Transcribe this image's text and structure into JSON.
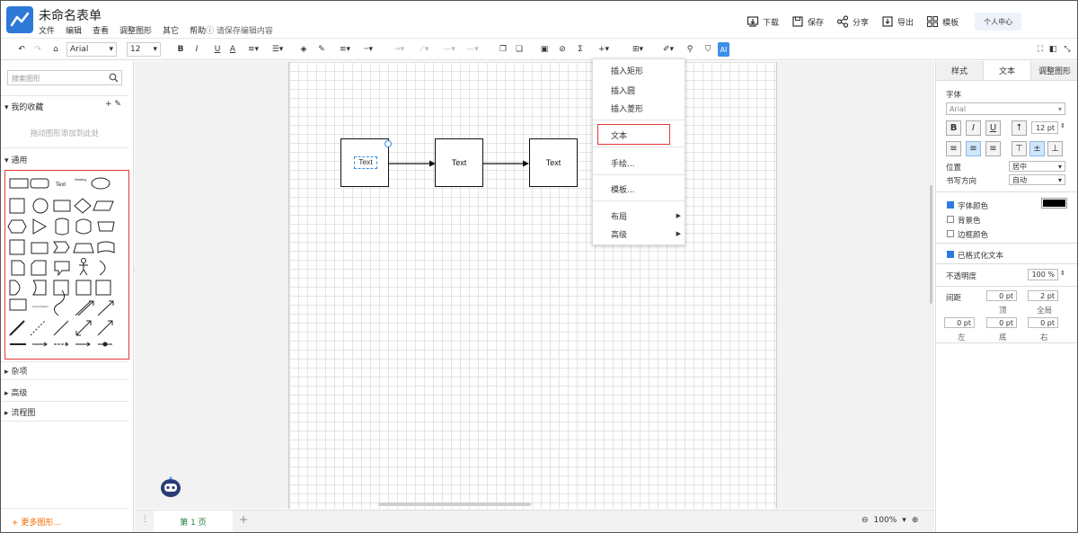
{
  "header": {
    "title": "未命名表单",
    "menu": [
      "文件",
      "编辑",
      "查看",
      "调整图形",
      "其它",
      "帮助"
    ],
    "autosave": "请保存编辑内容",
    "actions": [
      {
        "icon": "download-icon",
        "label": "下载"
      },
      {
        "icon": "save-icon",
        "label": "保存"
      },
      {
        "icon": "share-icon",
        "label": "分享"
      },
      {
        "icon": "export-icon",
        "label": "导出"
      },
      {
        "icon": "template-icon",
        "label": "模板"
      }
    ],
    "personal": "个人中心"
  },
  "toolbar": {
    "font": "Arial",
    "size": "12",
    "ai": "AI"
  },
  "left": {
    "search_placeholder": "搜索图形",
    "favorites": "我的收藏",
    "favorites_hint": "拖动图形添加到此处",
    "general": "通用",
    "misc": "杂项",
    "advanced": "高级",
    "flowchart": "流程图",
    "more": "+ 更多图形..."
  },
  "canvas": {
    "nodes": [
      "Text",
      "Text",
      "Text"
    ],
    "edit_text": "Text"
  },
  "context_menu": {
    "items": [
      "插入矩形",
      "插入圆",
      "插入菱形",
      "文本",
      "手绘...",
      "模板...",
      "布局",
      "高级"
    ]
  },
  "pages": {
    "tab": "第 1 页",
    "zoom": "100%"
  },
  "right": {
    "tabs": [
      "样式",
      "文本",
      "调整图形"
    ],
    "font_label": "字体",
    "font_value": "Arial",
    "size_value": "12 pt",
    "position_label": "位置",
    "position_value": "居中",
    "direction_label": "书写方向",
    "direction_value": "自动",
    "font_color": "字体颜色",
    "bg_color": "背景色",
    "border_color": "边框颜色",
    "formatted": "已格式化文本",
    "opacity_label": "不透明度",
    "opacity_value": "100 %",
    "spacing_label": "间距",
    "top_value": "0 pt",
    "global_value": "2 pt",
    "top_label": "顶",
    "global_label": "全局",
    "left_value": "0 pt",
    "bottom_value": "0 pt",
    "right_value": "0 pt",
    "left_label": "左",
    "bottom_label": "底",
    "right_label": "右"
  },
  "colors": {
    "accent": "#2e79d8",
    "highlight": "#e53935",
    "font_color_swatch": "#000000"
  }
}
